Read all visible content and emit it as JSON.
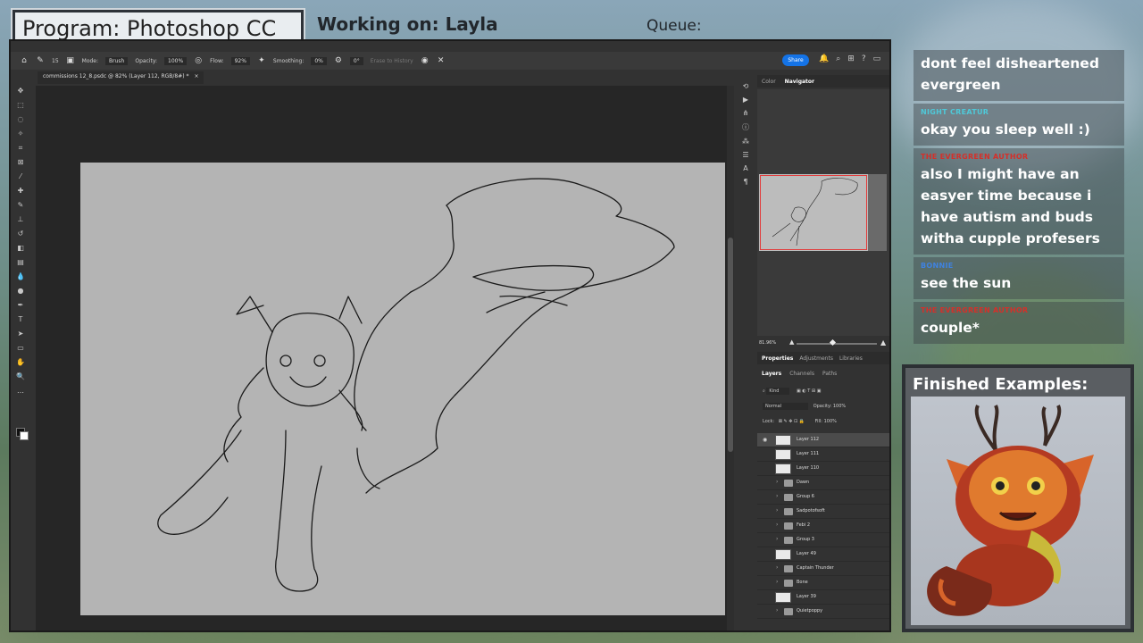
{
  "overlay": {
    "program_label": "Program: Photoshop CC",
    "working_on_label": "Working on: Layla",
    "queue_label": "Queue:"
  },
  "photoshop": {
    "options_bar": {
      "mode_label": "Mode:",
      "mode_value": "Brush",
      "opacity_label": "Opacity:",
      "opacity_value": "100%",
      "flow_label": "Flow:",
      "flow_value": "92%",
      "smoothing_label": "Smoothing:",
      "smoothing_value": "0%",
      "angle_value": "0°",
      "clear_history": "Erase to History",
      "brush_size": "15",
      "share_label": "Share"
    },
    "document_tab": "commissions 12_8.psdc @ 82% (Layer 112, RGB/8#) *",
    "color_tabs": {
      "color": "Color",
      "navigator": "Navigator"
    },
    "zoom_value": "81.96%",
    "properties_tabs": {
      "properties": "Properties",
      "adjustments": "Adjustments",
      "libraries": "Libraries"
    },
    "layers_tabs": {
      "layers": "Layers",
      "channels": "Channels",
      "paths": "Paths"
    },
    "layer_controls": {
      "kind": "Kind",
      "blend_mode": "Normal",
      "opacity_label": "Opacity:",
      "opacity_value": "100%",
      "lock_label": "Lock:",
      "fill_label": "Fill:",
      "fill_value": "100%"
    },
    "layers": [
      {
        "name": "Layer 112",
        "type": "layer",
        "selected": true,
        "visible": true
      },
      {
        "name": "Layer 111",
        "type": "layer",
        "selected": false,
        "visible": false
      },
      {
        "name": "Layer 110",
        "type": "layer",
        "selected": false,
        "visible": false
      },
      {
        "name": "Dawn",
        "type": "group",
        "selected": false,
        "visible": false
      },
      {
        "name": "Group 6",
        "type": "group",
        "selected": false,
        "visible": false
      },
      {
        "name": "Sadpotofsoft",
        "type": "group",
        "selected": false,
        "visible": false
      },
      {
        "name": "Febi 2",
        "type": "group",
        "selected": false,
        "visible": false
      },
      {
        "name": "Group 3",
        "type": "group",
        "selected": false,
        "visible": false
      },
      {
        "name": "Layer 49",
        "type": "layer",
        "selected": false,
        "visible": false
      },
      {
        "name": "Captain Thunder",
        "type": "group",
        "selected": false,
        "visible": false
      },
      {
        "name": "Bone",
        "type": "group",
        "selected": false,
        "visible": false
      },
      {
        "name": "Layer 39",
        "type": "layer",
        "selected": false,
        "visible": false
      },
      {
        "name": "Quietpoppy",
        "type": "group",
        "selected": false,
        "visible": false
      }
    ]
  },
  "chat": [
    {
      "user": "",
      "user_color": "#6fd3e0",
      "text": "dont feel disheartened evergreen"
    },
    {
      "user": "NIGHT CREATUR",
      "user_color": "#4fc8d8",
      "text": "okay you sleep well :)"
    },
    {
      "user": "THE EVERGREEN AUTHOR",
      "user_color": "#d4302a",
      "text": "also I might have an easyer time because i have autism and buds witha cupple profesers"
    },
    {
      "user": "BONNIE",
      "user_color": "#3f82e0",
      "text": "see the sun"
    },
    {
      "user": "THE EVERGREEN AUTHOR",
      "user_color": "#d4302a",
      "text": "couple*"
    }
  ],
  "examples": {
    "title": "Finished Examples:"
  },
  "colors": {
    "accent": "#1473e6",
    "canvas": "#b4b4b4",
    "ps_bg": "#323232"
  }
}
